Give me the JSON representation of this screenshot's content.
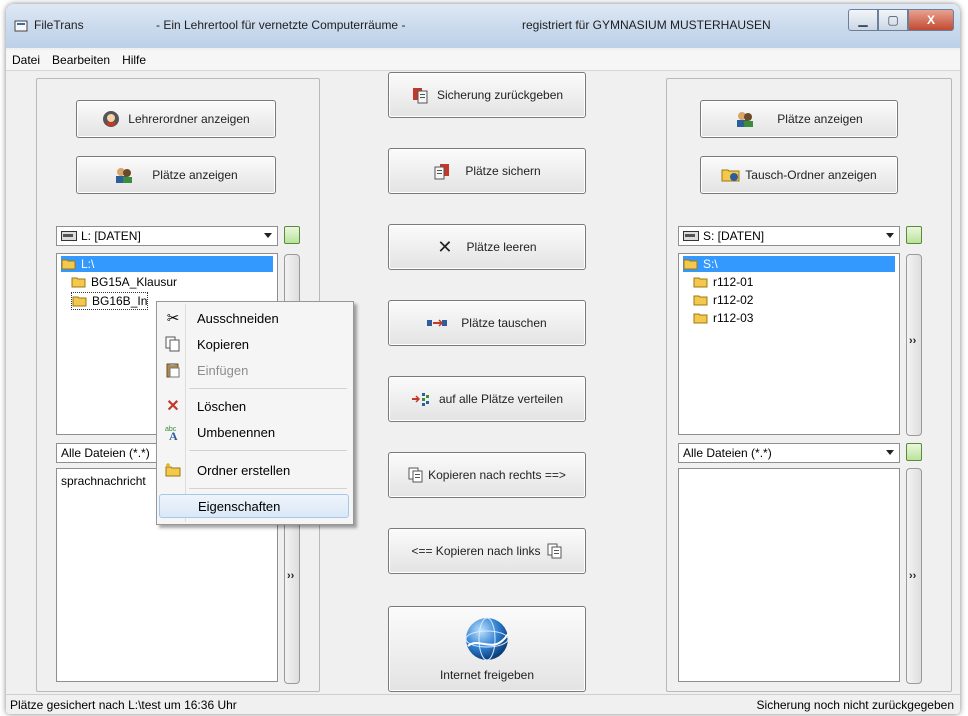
{
  "window": {
    "app_name": "FileTrans",
    "subtitle": "- Ein Lehrertool für vernetzte Computerräume -",
    "registered": "registriert für GYMNASIUM MUSTERHAUSEN",
    "minimize": "▁",
    "maximize": "▢",
    "close": "X"
  },
  "menu": [
    "Datei",
    "Bearbeiten",
    "Hilfe"
  ],
  "left": {
    "btn_teacher_folder": "Lehrerordner anzeigen",
    "btn_show_seats": "Plätze anzeigen",
    "drive": "L: [DATEN]",
    "tree": [
      "L:\\",
      "BG15A_Klausur",
      "BG16B_In"
    ],
    "filter": "Alle Dateien (*.*)",
    "files": [
      "sprachnachricht"
    ],
    "more": "››"
  },
  "center": {
    "restore": "Sicherung zurückgeben",
    "backup": "Plätze sichern",
    "clear": "Plätze leeren",
    "swap": "Plätze tauschen",
    "distribute": "auf alle Plätze verteilen",
    "copy_right": "Kopieren nach rechts ==>",
    "copy_left": "<== Kopieren nach links",
    "internet": "Internet freigeben"
  },
  "right": {
    "btn_show_seats": "Plätze anzeigen",
    "btn_swap_folder": "Tausch-Ordner anzeigen",
    "drive": "S: [DATEN]",
    "tree": [
      "S:\\",
      "r112-01",
      "r112-02",
      "r112-03"
    ],
    "filter": "Alle Dateien (*.*)",
    "more": "››"
  },
  "context_menu": {
    "cut": "Ausschneiden",
    "copy": "Kopieren",
    "paste": "Einfügen",
    "delete": "Löschen",
    "rename": "Umbenennen",
    "new_folder": "Ordner erstellen",
    "properties": "Eigenschaften"
  },
  "status": {
    "left": "Plätze gesichert nach L:\\test um 16:36 Uhr",
    "right": "Sicherung noch nicht zurückgegeben"
  },
  "colors": {
    "selection": "#3399ff",
    "folder": "#f2c94c",
    "delete_icon": "#c0392b"
  }
}
